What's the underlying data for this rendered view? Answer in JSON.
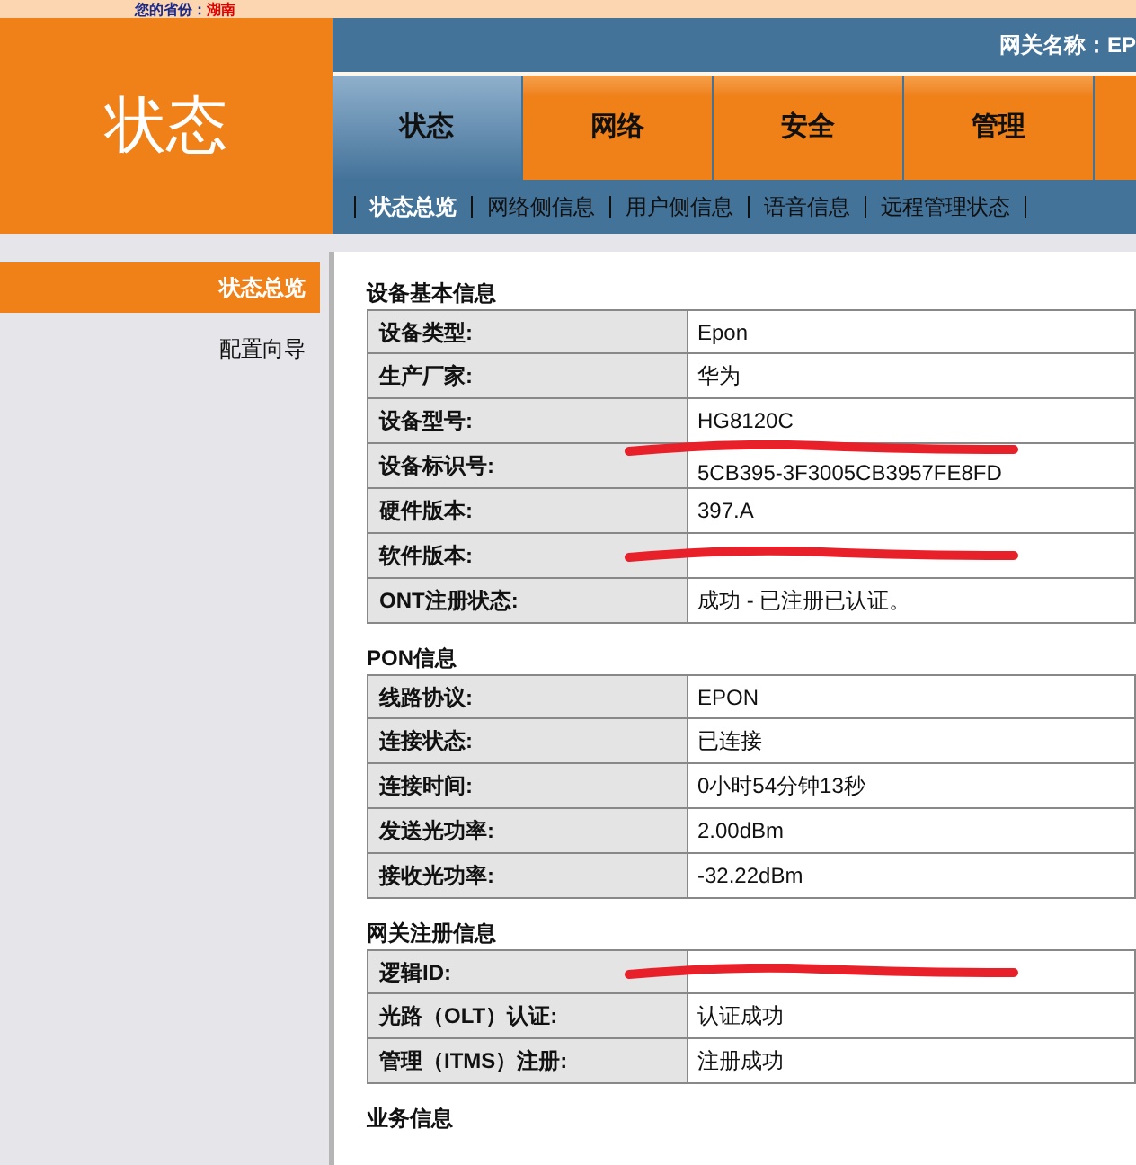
{
  "top_bar": {
    "label": "您的省份：",
    "province": "湖南"
  },
  "logo": {
    "title": "状态"
  },
  "gateway": {
    "label": "网关名称：EP"
  },
  "tabs": [
    {
      "label": "状态",
      "selected": true
    },
    {
      "label": "网络",
      "selected": false
    },
    {
      "label": "安全",
      "selected": false
    },
    {
      "label": "管理",
      "selected": false
    }
  ],
  "sub_nav": [
    {
      "label": "状态总览",
      "selected": true
    },
    {
      "label": "网络侧信息",
      "selected": false
    },
    {
      "label": "用户侧信息",
      "selected": false
    },
    {
      "label": "语音信息",
      "selected": false
    },
    {
      "label": "远程管理状态",
      "selected": false
    }
  ],
  "sidebar": {
    "items": [
      {
        "label": "状态总览",
        "selected": true
      },
      {
        "label": "配置向导",
        "selected": false
      }
    ]
  },
  "sections": [
    {
      "title": "设备基本信息",
      "rows": [
        {
          "label": "设备类型:",
          "value": "Epon",
          "redacted": false
        },
        {
          "label": "生产厂家:",
          "value": "华为",
          "redacted": false
        },
        {
          "label": "设备型号:",
          "value": "HG8120C",
          "redacted": false
        },
        {
          "label": "设备标识号:",
          "value": "5CB395-3F3005CB3957FE8FD",
          "redacted": true
        },
        {
          "label": "硬件版本:",
          "value": "397.A",
          "redacted": false
        },
        {
          "label": "软件版本:",
          "redacted": true
        },
        {
          "label": "ONT注册状态:",
          "value": "成功 - 已注册已认证。",
          "redacted": false
        }
      ]
    },
    {
      "title": "PON信息",
      "rows": [
        {
          "label": "线路协议:",
          "value": "EPON",
          "redacted": false
        },
        {
          "label": "连接状态:",
          "value": "已连接",
          "redacted": false
        },
        {
          "label": "连接时间:",
          "value": "0小时54分钟13秒",
          "redacted": false
        },
        {
          "label": "发送光功率:",
          "value": "2.00dBm",
          "redacted": false
        },
        {
          "label": "接收光功率:",
          "value": "-32.22dBm",
          "redacted": false
        }
      ]
    },
    {
      "title": "网关注册信息",
      "rows": [
        {
          "label": "逻辑ID:",
          "redacted": true
        },
        {
          "label": "光路（OLT）认证:",
          "value": "认证成功",
          "redacted": false
        },
        {
          "label": "管理（ITMS）注册:",
          "value": "注册成功",
          "redacted": false
        }
      ]
    },
    {
      "title": "业务信息"
    }
  ]
}
